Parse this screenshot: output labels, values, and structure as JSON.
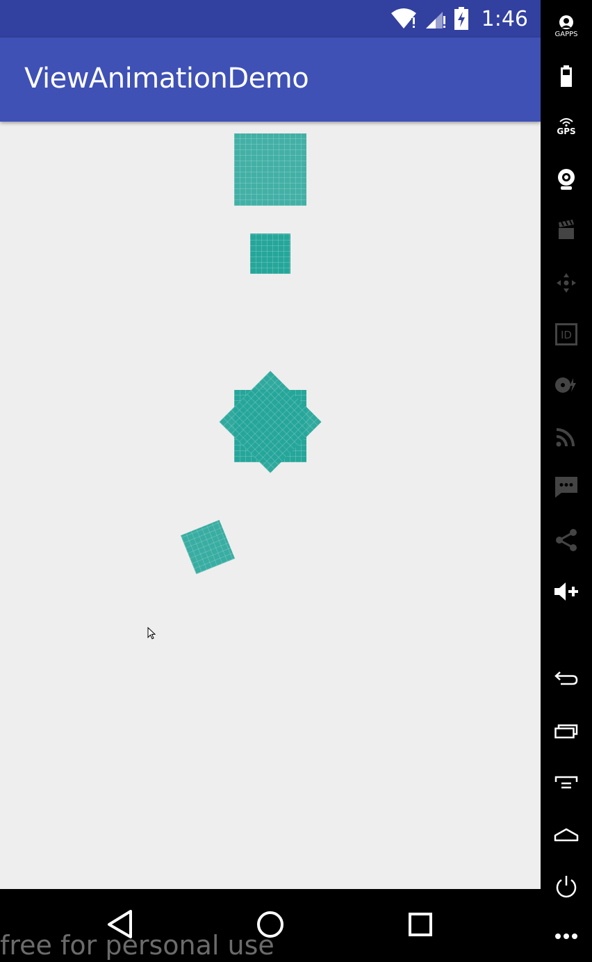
{
  "status_bar": {
    "time": "1:46"
  },
  "app_bar": {
    "title": "ViewAnimationDemo"
  },
  "watermark": "free for personal use",
  "side_panel": {
    "gapps_label": "GAPPS",
    "gps_label": "GPS",
    "id_label": "ID"
  },
  "colors": {
    "status_bar": "#3240A0",
    "app_bar": "#3F51B5",
    "content_bg": "#EEEEEE",
    "tile": "#26A69A"
  }
}
